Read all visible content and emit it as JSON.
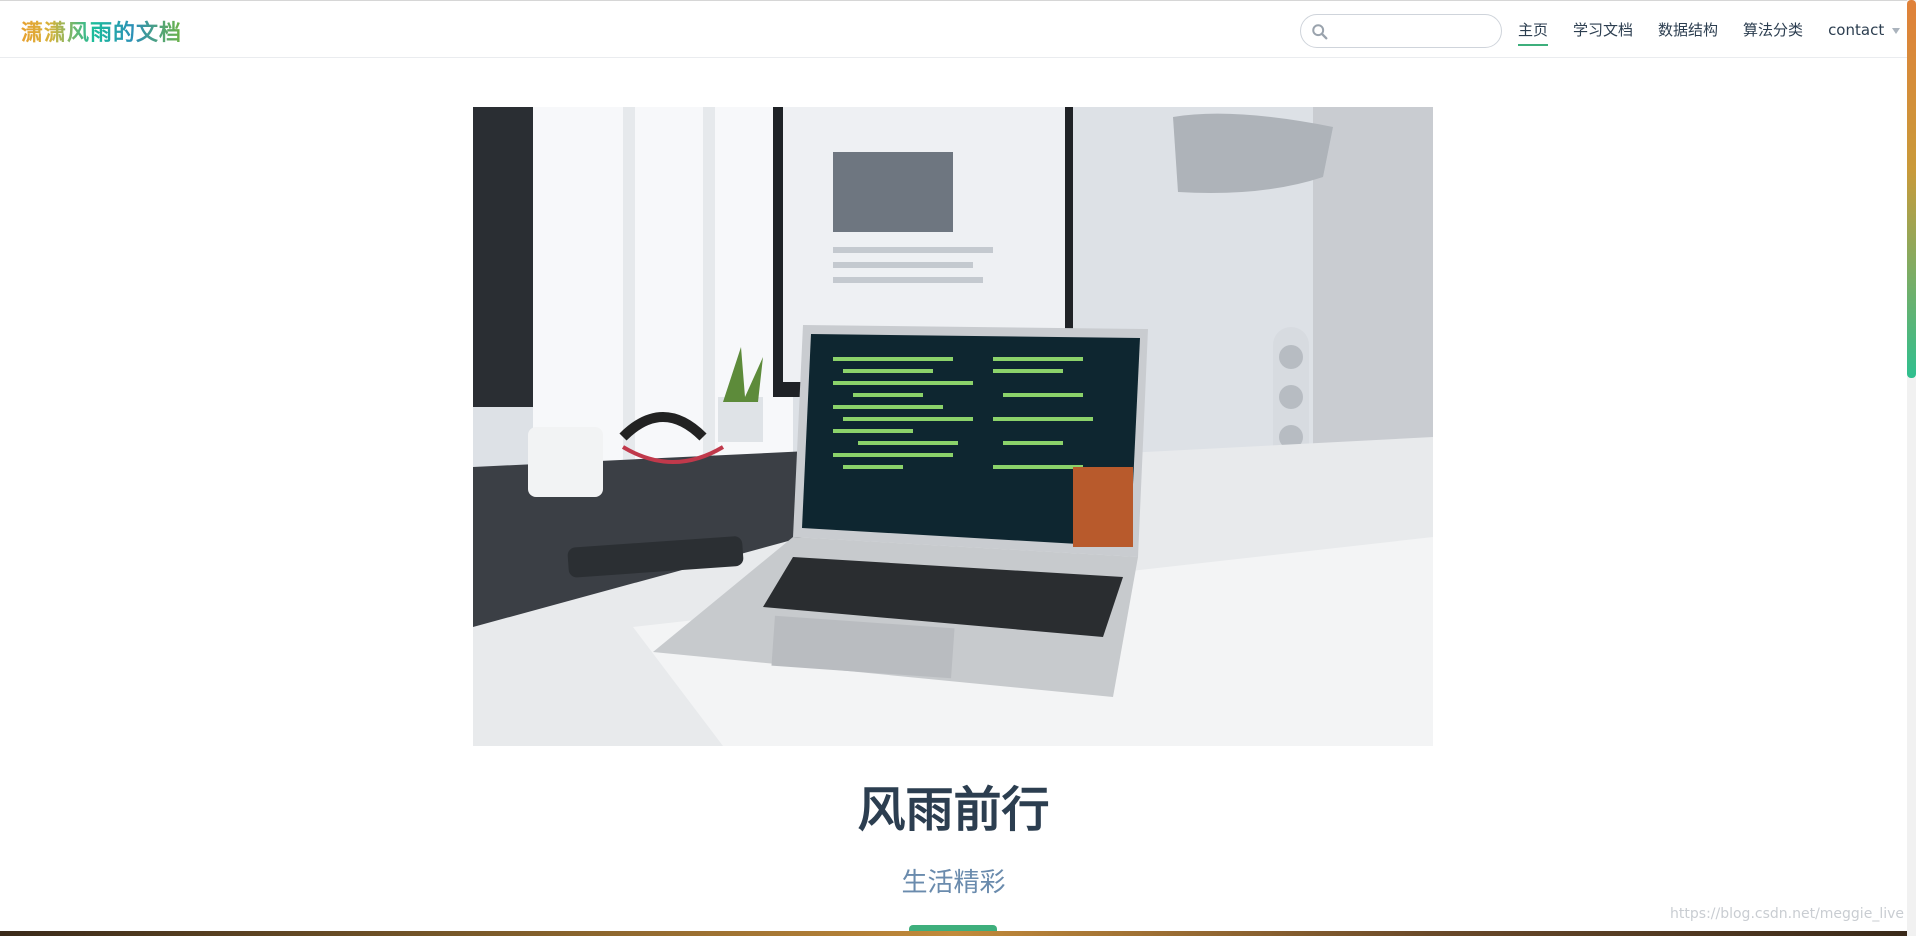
{
  "site": {
    "logo_text": "潇潇风雨的文档"
  },
  "search": {
    "placeholder": "",
    "value": ""
  },
  "nav": {
    "items": [
      {
        "label": "主页",
        "active": true
      },
      {
        "label": "学习文档",
        "active": false
      },
      {
        "label": "数据结构",
        "active": false
      },
      {
        "label": "算法分类",
        "active": false
      },
      {
        "label": "contact",
        "active": false,
        "dropdown": true
      }
    ]
  },
  "hero": {
    "title": "风雨前行",
    "description": "生活精彩",
    "action_label": ""
  },
  "watermark": "https://blog.csdn.net/meggie_live",
  "colors": {
    "accent": "#3eaf7c",
    "text": "#2c3e50",
    "description": "#6a8bad"
  },
  "icons": {
    "search": "search-icon",
    "dropdown": "chevron-down-icon"
  }
}
